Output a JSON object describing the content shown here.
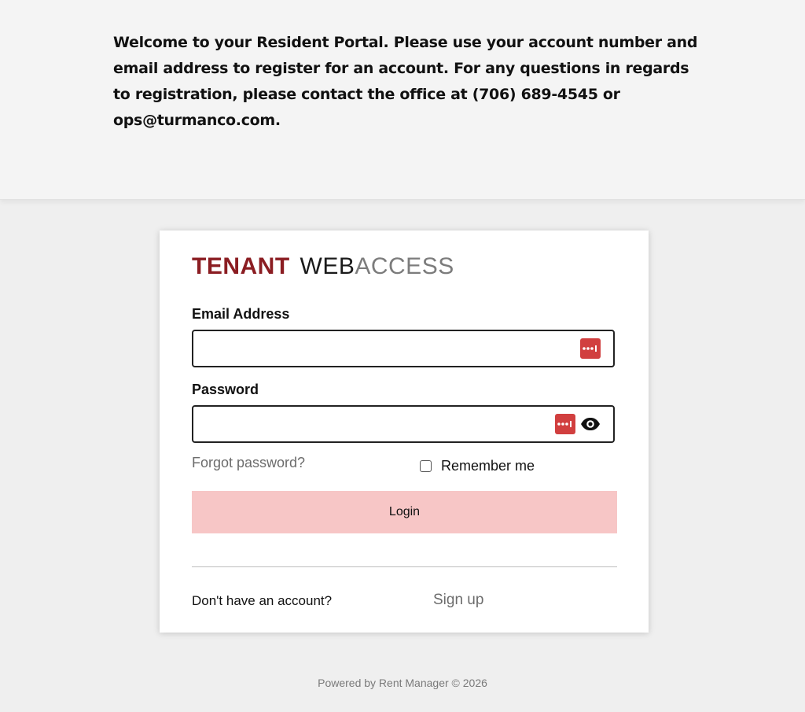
{
  "banner": {
    "welcome_text": "Welcome to your Resident Portal.  Please use your account number and email address to register for an account.  For any questions in regards to registration, please contact the office at (706) 689-4545 or ops@turmanco.com."
  },
  "brand": {
    "part1": "TENANT",
    "part2": "WEB",
    "part3": "ACCESS"
  },
  "form": {
    "email_label": "Email Address",
    "email_value": "",
    "password_label": "Password",
    "password_value": "",
    "forgot_label": "Forgot password?",
    "remember_label": "Remember me",
    "remember_checked": false,
    "login_label": "Login",
    "no_account_label": "Don't have an account?",
    "signup_label": "Sign up"
  },
  "footer": {
    "text": "Powered by Rent Manager © 2026"
  },
  "icons": {
    "password_manager": "password-manager-icon",
    "show_password": "eye-icon"
  },
  "colors": {
    "brand_red": "#8b1d22",
    "login_button": "#f7c6c6",
    "password_manager": "#d13f3f"
  }
}
